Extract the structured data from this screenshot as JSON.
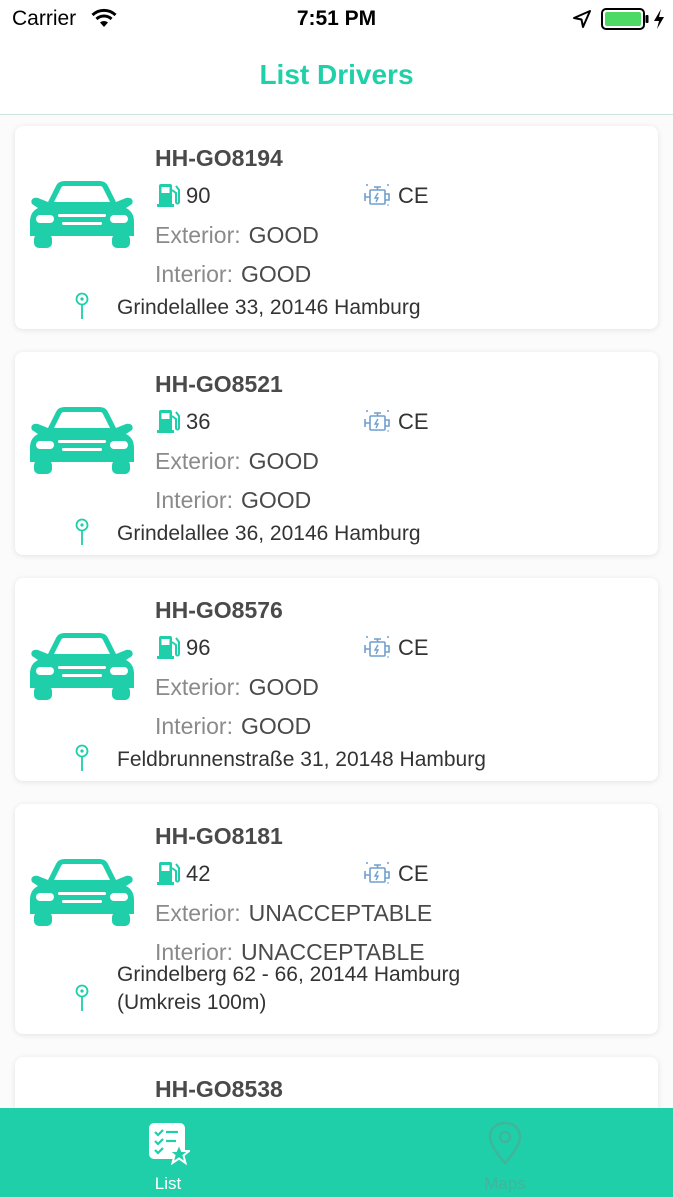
{
  "status_bar": {
    "carrier": "Carrier",
    "time": "7:51 PM"
  },
  "nav": {
    "title": "List Drivers"
  },
  "colors": {
    "accent": "#1fd0a8",
    "tab_bar": "#1ecfaa",
    "engine_icon": "#6f9fce"
  },
  "drivers": [
    {
      "plate": "HH-GO8194",
      "fuel": "90",
      "engine": "CE",
      "exterior_label": "Exterior:",
      "exterior": "GOOD",
      "interior_label": "Interior:",
      "interior": "GOOD",
      "address": "Grindelallee 33, 20146 Hamburg"
    },
    {
      "plate": "HH-GO8521",
      "fuel": "36",
      "engine": "CE",
      "exterior_label": "Exterior:",
      "exterior": "GOOD",
      "interior_label": "Interior:",
      "interior": "GOOD",
      "address": "Grindelallee 36, 20146 Hamburg"
    },
    {
      "plate": "HH-GO8576",
      "fuel": "96",
      "engine": "CE",
      "exterior_label": "Exterior:",
      "exterior": "GOOD",
      "interior_label": "Interior:",
      "interior": "GOOD",
      "address": "Feldbrunnenstraße 31, 20148 Hamburg"
    },
    {
      "plate": "HH-GO8181",
      "fuel": "42",
      "engine": "CE",
      "exterior_label": "Exterior:",
      "exterior": "UNACCEPTABLE",
      "interior_label": "Interior:",
      "interior": "UNACCEPTABLE",
      "address": "Grindelberg 62 - 66, 20144 Hamburg (Umkreis 100m)"
    },
    {
      "plate": "HH-GO8538"
    }
  ],
  "tabs": [
    {
      "label": "List",
      "icon": "checklist-star-icon",
      "active": true
    },
    {
      "label": "Maps",
      "icon": "map-pin-icon",
      "active": false
    }
  ]
}
